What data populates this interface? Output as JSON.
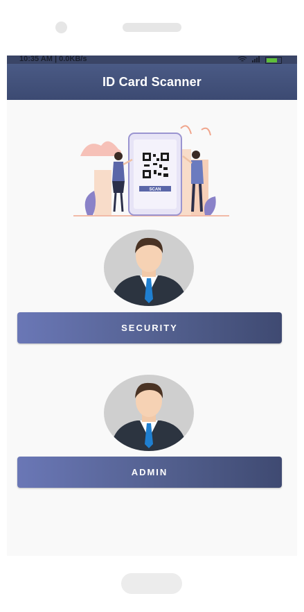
{
  "status_bar": {
    "time_info": "10:35 AM | 0.0KB/s",
    "icons": [
      "wifi-icon",
      "signal-icon",
      "battery-icon"
    ],
    "battery": "83"
  },
  "app_bar": {
    "title": "ID Card Scanner"
  },
  "illustration": {
    "scan_label": "SCAN"
  },
  "roles": [
    {
      "label": "SECURITY",
      "avatar_icon": "businessman-avatar-icon"
    },
    {
      "label": "ADMIN",
      "avatar_icon": "businessman-avatar-icon"
    }
  ],
  "colors": {
    "app_bar": "#3c4a72",
    "button_gradient_start": "#6a77b6",
    "button_gradient_end": "#3f4a72",
    "screen_bg": "#f9f9f9"
  }
}
